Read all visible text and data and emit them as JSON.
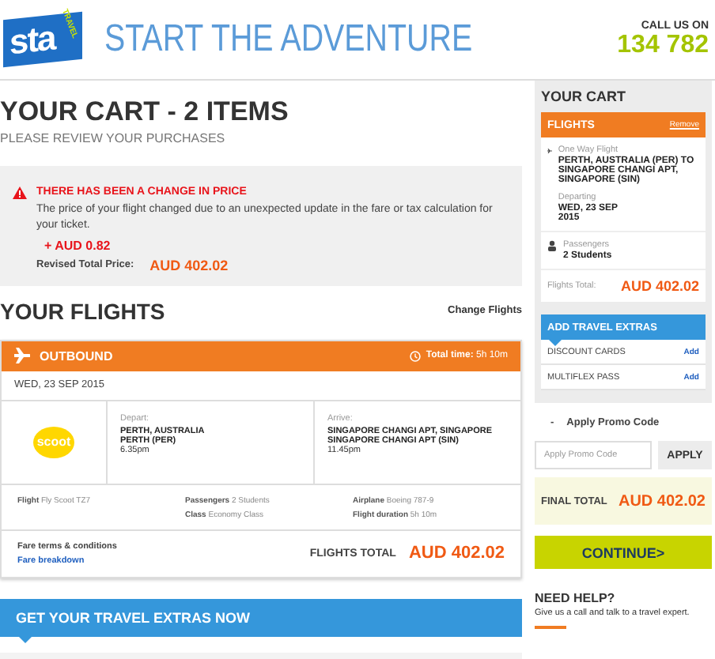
{
  "header": {
    "logo": "sta",
    "logo_sub": "TRAVEL",
    "tagline": "START THE ADVENTURE",
    "call_label": "CALL US ON",
    "phone": "134 782"
  },
  "cart": {
    "title": "YOUR CART - 2 ITEMS",
    "subtitle": "PLEASE REVIEW YOUR PURCHASES"
  },
  "alert": {
    "title": "THERE HAS BEEN A CHANGE IN PRICE",
    "message": "The price of your flight changed due to an unexpected update in the fare or tax calculation for your ticket.",
    "change": "+ AUD 0.82",
    "revised_label": "Revised Total Price:",
    "revised_price": "AUD 402.02"
  },
  "flights": {
    "title": "YOUR FLIGHTS",
    "change_link": "Change Flights",
    "outbound": {
      "label": "OUTBOUND",
      "total_time_label": "Total time:",
      "total_time": "5h 10m"
    },
    "date": "WED, 23 SEP 2015",
    "airline_logo": "scoot",
    "legs": [
      {
        "label": "Depart:",
        "city": "PERTH, AUSTRALIA",
        "airport": "PERTH (PER)",
        "time": "6.35pm"
      },
      {
        "label": "Arrive:",
        "city": "SINGAPORE CHANGI APT, SINGAPORE",
        "airport": "SINGAPORE CHANGI APT (SIN)",
        "time": "11.45pm"
      }
    ],
    "details": [
      [
        {
          "label": "Flight",
          "value": "Fly Scoot TZ7"
        }
      ],
      [
        {
          "label": "Passengers",
          "value": "2 Students"
        },
        {
          "label": "Class",
          "value": "Economy Class"
        }
      ],
      [
        {
          "label": "Airplane",
          "value": "Boeing 787-9"
        },
        {
          "label": "Flight duration",
          "value": "5h 10m"
        }
      ]
    ],
    "fare_terms": "Fare terms & conditions",
    "fare_breakdown": "Fare breakdown",
    "total_label": "FLIGHTS TOTAL",
    "total": "AUD 402.02"
  },
  "extras_banner": "GET YOUR TRAVEL EXTRAS NOW",
  "sidebar": {
    "title": "YOUR CART",
    "flights_header": "FLIGHTS",
    "remove": "Remove",
    "trip_label": "One Way Flight",
    "route": "PERTH, AUSTRALIA (PER)  TO SINGAPORE CHANGI APT, SINGAPORE (SIN)",
    "departing_label": "Departing",
    "departing_date": "WED, 23 SEP 2015",
    "passengers_label": "Passengers",
    "passengers": "2 Students",
    "total_label": "Flights Total:",
    "total": "AUD 402.02",
    "extras_title": "ADD TRAVEL EXTRAS",
    "extras": [
      {
        "name": "DISCOUNT CARDS",
        "action": "Add"
      },
      {
        "name": "MULTIFLEX PASS",
        "action": "Add"
      }
    ],
    "promo": {
      "toggle": "-",
      "label": "Apply Promo Code",
      "placeholder": "Apply Promo Code",
      "button": "APPLY"
    },
    "final_label": "FINAL TOTAL",
    "final_total": "AUD 402.02",
    "continue": "CONTINUE>",
    "help_title": "NEED HELP?",
    "help_text": "Give us a call and talk to a travel expert."
  }
}
